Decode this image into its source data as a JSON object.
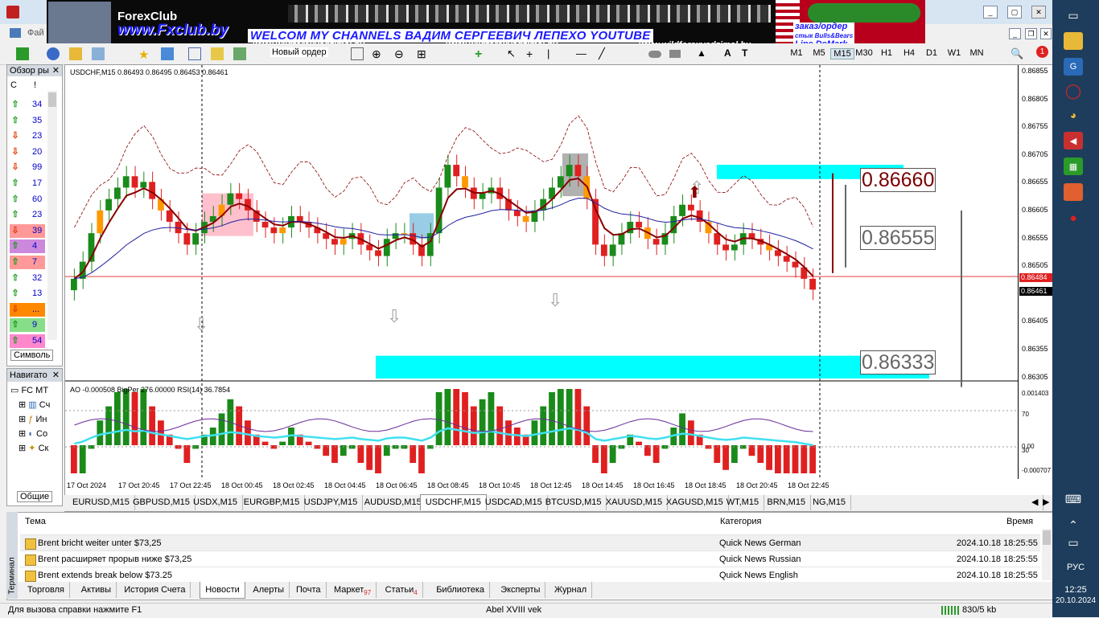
{
  "menu": {
    "file_label": "Фай"
  },
  "toolbar": {
    "new_order_label": "Новый ордер",
    "timeframes": [
      "M1",
      "M5",
      "M15",
      "M30",
      "H1",
      "H4",
      "D1",
      "W1",
      "MN"
    ],
    "notification_badge": "1"
  },
  "banner": {
    "logo_text": "ForexClub",
    "site_url": "www.Fxclub.by",
    "welcome_text": "WELCOM MY CHANNELS ВАДИМ СЕРГЕЕВИЧ ЛЕПЕХО YOUTUBE",
    "sub_url": "www.wildforexvadzimsl.by",
    "order_lines": [
      "заказ/ордер",
      "стык Bulls&Bears",
      "Line DeMark"
    ]
  },
  "market_watch": {
    "title": "Обзор ры",
    "col1": "С",
    "col2": "!",
    "rows": [
      {
        "dir": "up",
        "value": "34",
        "bg": "#ffffff"
      },
      {
        "dir": "up",
        "value": "35",
        "bg": "#ffffff"
      },
      {
        "dir": "down",
        "value": "23",
        "bg": "#ffffff"
      },
      {
        "dir": "down",
        "value": "20",
        "bg": "#ffffff"
      },
      {
        "dir": "down",
        "value": "99",
        "bg": "#ffffff"
      },
      {
        "dir": "up",
        "value": "17",
        "bg": "#ffffff"
      },
      {
        "dir": "up",
        "value": "60",
        "bg": "#ffffff"
      },
      {
        "dir": "up",
        "value": "23",
        "bg": "#ffffff"
      },
      {
        "dir": "down",
        "value": "39",
        "bg": "#ff9999"
      },
      {
        "dir": "up",
        "value": "4",
        "bg": "#cc88dd"
      },
      {
        "dir": "up",
        "value": "7",
        "bg": "#ff9999"
      },
      {
        "dir": "up",
        "value": "32",
        "bg": "#ffffff"
      },
      {
        "dir": "up",
        "value": "13",
        "bg": "#ffffff"
      },
      {
        "dir": "down",
        "value": "...",
        "bg": "#ff8800"
      },
      {
        "dir": "up",
        "value": "9",
        "bg": "#88dd88"
      },
      {
        "dir": "up",
        "value": "54",
        "bg": "#ff88cc"
      }
    ],
    "tab_label": "Символь"
  },
  "navigator": {
    "title": "Навигато",
    "items": [
      "FC MT",
      "Сч",
      "Ин",
      "Со",
      "Ск"
    ],
    "tab_label": "Общие"
  },
  "chart": {
    "header": "USDCHF,M15  0.86493 0.86495 0.86453 0.86461",
    "indicator_header": "AO -0.000508  BigPer 276.00000  RSI(14) 36.7854",
    "price_labels": [
      "0.86855",
      "0.86805",
      "0.86755",
      "0.86705",
      "0.86655",
      "0.86605",
      "0.86555",
      "0.86505",
      "0.86455",
      "0.86405",
      "0.86355",
      "0.86305"
    ],
    "bid_tag": "0.86484",
    "current_tag": "0.86461",
    "indicator_labels": [
      "0.001403",
      "70",
      "0.00",
      "30",
      "-0.000707"
    ],
    "time_labels": [
      "17 Oct 2024",
      "17 Oct 20:45",
      "17 Oct 22:45",
      "18 Oct 00:45",
      "18 Oct 02:45",
      "18 Oct 04:45",
      "18 Oct 06:45",
      "18 Oct 08:45",
      "18 Oct 10:45",
      "18 Oct 12:45",
      "18 Oct 14:45",
      "18 Oct 16:45",
      "18 Oct 18:45",
      "18 Oct 20:45",
      "18 Oct 22:45"
    ],
    "level_high": "0.86660",
    "level_mid": "0.86555",
    "level_low": "0.86333"
  },
  "chart_data": {
    "type": "candlestick",
    "symbol": "USDCHF,M15",
    "ohlc_current": {
      "open": 0.86493,
      "high": 0.86495,
      "low": 0.86453,
      "close": 0.86461
    },
    "ylim": [
      0.86305,
      0.86855
    ],
    "closes": [
      0.8648,
      0.8651,
      0.8656,
      0.866,
      0.8662,
      0.8664,
      0.8666,
      0.8664,
      0.8665,
      0.8662,
      0.866,
      0.8658,
      0.8656,
      0.8654,
      0.8656,
      0.8658,
      0.8659,
      0.8661,
      0.8663,
      0.8662,
      0.866,
      0.8658,
      0.8657,
      0.8656,
      0.8657,
      0.8659,
      0.8658,
      0.8657,
      0.8656,
      0.8655,
      0.8654,
      0.8655,
      0.8656,
      0.8654,
      0.8653,
      0.8652,
      0.8655,
      0.8656,
      0.8656,
      0.8654,
      0.8652,
      0.8656,
      0.8664,
      0.8668,
      0.8666,
      0.8664,
      0.8662,
      0.8663,
      0.8664,
      0.8662,
      0.866,
      0.8659,
      0.8658,
      0.866,
      0.8662,
      0.8664,
      0.8666,
      0.8668,
      0.8666,
      0.8662,
      0.8654,
      0.8652,
      0.8654,
      0.8656,
      0.8658,
      0.8657,
      0.8655,
      0.8654,
      0.8656,
      0.8659,
      0.8661,
      0.866,
      0.8658,
      0.8656,
      0.8654,
      0.8653,
      0.8654,
      0.8656,
      0.8655,
      0.8654,
      0.8653,
      0.8652,
      0.8651,
      0.865,
      0.8648,
      0.86461
    ]
  },
  "symbol_tabs": [
    "EURUSD,M15",
    "GBPUSD,M15",
    "USDX,M15",
    "EURGBP,M15",
    "USDJPY,M15",
    "AUDUSD,M15",
    "USDCHF,M15",
    "USDCAD,M15",
    "BTCUSD,M15",
    "XAUUSD,M15",
    "XAGUSD,M15",
    "WT,M15",
    "BRN,M15",
    "NG,M15"
  ],
  "terminal": {
    "side_label": "Терминал",
    "columns": {
      "topic": "Тема",
      "category": "Категория",
      "time": "Время"
    },
    "rows": [
      {
        "topic": "Brent bricht weiter unter $73,25",
        "category": "Quick News German",
        "time": "2024.10.18 18:25:55"
      },
      {
        "topic": "Brent расширяет прорыв ниже $73,25",
        "category": "Quick News Russian",
        "time": "2024.10.18 18:25:55"
      },
      {
        "topic": "Brent extends break below $73.25",
        "category": "Quick News English",
        "time": "2024.10.18 18:25:55"
      }
    ],
    "tabs": [
      {
        "label": "Торговля",
        "badge": ""
      },
      {
        "label": "Активы",
        "badge": ""
      },
      {
        "label": "История Счета",
        "badge": ""
      },
      {
        "label": "Новости",
        "badge": ""
      },
      {
        "label": "Алерты",
        "badge": ""
      },
      {
        "label": "Почта",
        "badge": ""
      },
      {
        "label": "Маркет",
        "badge": "97"
      },
      {
        "label": "Статьи",
        "badge": "4"
      },
      {
        "label": "Библиотека",
        "badge": ""
      },
      {
        "label": "Эксперты",
        "badge": ""
      },
      {
        "label": "Журнал",
        "badge": ""
      }
    ]
  },
  "status": {
    "help": "Для вызова справки нажмите F1",
    "profile": "Abel XVIII vek",
    "traffic": "830/5 kb"
  },
  "taskbar": {
    "lang": "РУС",
    "time": "12:25",
    "date": "20.10.2024"
  }
}
